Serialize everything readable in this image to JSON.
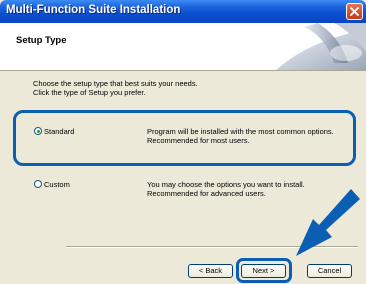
{
  "window": {
    "title": "Multi-Function Suite Installation"
  },
  "header": {
    "title": "Setup Type"
  },
  "instructions": [
    "Choose the setup type that best suits your needs.",
    "Click the type of Setup you prefer."
  ],
  "options": [
    {
      "label": "Standard",
      "selected": true,
      "description": [
        "Program will be installed with the most common options.",
        "Recommended for most users."
      ]
    },
    {
      "label": "Custom",
      "selected": false,
      "description": [
        "You may choose the options you want to install.",
        "Recommended for advanced users."
      ]
    }
  ],
  "buttons": {
    "back": "< Back",
    "next": "Next >",
    "cancel": "Cancel"
  },
  "colors": {
    "highlight": "#0a5fb4",
    "titlebar": "#0a4fd0",
    "radio_dot": "#21a121"
  }
}
